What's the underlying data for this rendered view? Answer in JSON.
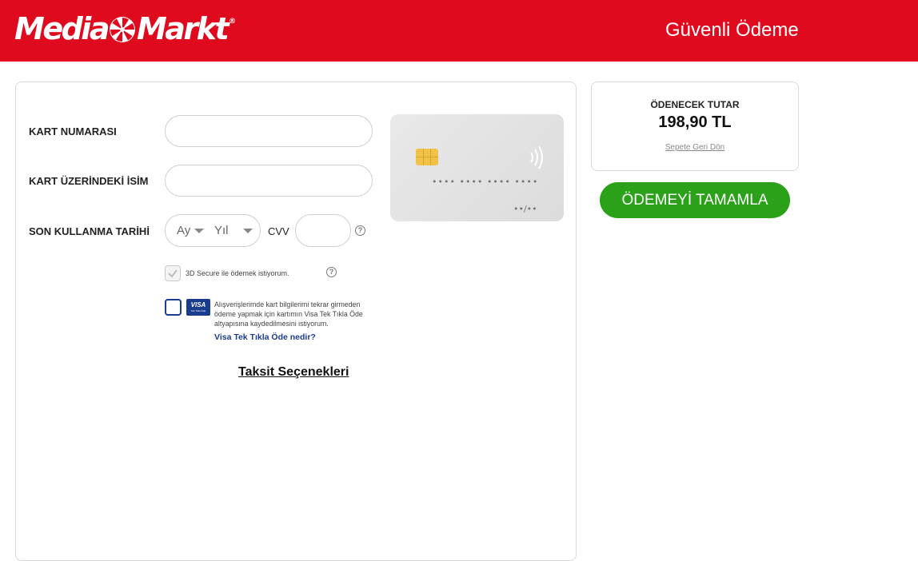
{
  "header": {
    "logo_text_1": "Media",
    "logo_text_2": "Markt",
    "logo_reg": "®",
    "title": "Güvenli Ödeme",
    "brand_color": "#df0a1e"
  },
  "form": {
    "card_number_label": "KART NUMARASI",
    "card_number_value": "",
    "card_name_label": "KART ÜZERİNDEKİ İSİM",
    "card_name_value": "",
    "expiry_label": "SON KULLANMA TARİHİ",
    "month_placeholder": "Ay",
    "year_placeholder": "Yıl",
    "cvv_label": "CVV",
    "cvv_value": "",
    "help_symbol": "?",
    "secure3d_label": "3D Secure ile ödemek istiyorum.",
    "secure3d_checked": true,
    "visa_logo_text": "VISA",
    "visa_logo_sub": "Tek Tıkla Öde",
    "visa_save_text": "Alışverişlerimde kart bilgilerimi tekrar girmeden ödeme yapmak için kartımın Visa Tek Tıkla Öde altyapısına kaydedilmesini istiyorum.",
    "visa_save_checked": false,
    "visa_link": "Visa Tek Tıkla Öde nedir?",
    "installments_link": "Taksit Seçenekleri"
  },
  "card_preview": {
    "number_mask": "•••• •••• •••• ••••",
    "expiry_mask": "••/••",
    "chip_color": "#f1c24a"
  },
  "summary": {
    "label": "ÖDENECEK TUTAR",
    "amount": "198,90 TL",
    "back_link": "Sepete Geri Dön"
  },
  "actions": {
    "pay_button": "ÖDEMEYİ TAMAMLA",
    "pay_color": "#2aa119"
  }
}
